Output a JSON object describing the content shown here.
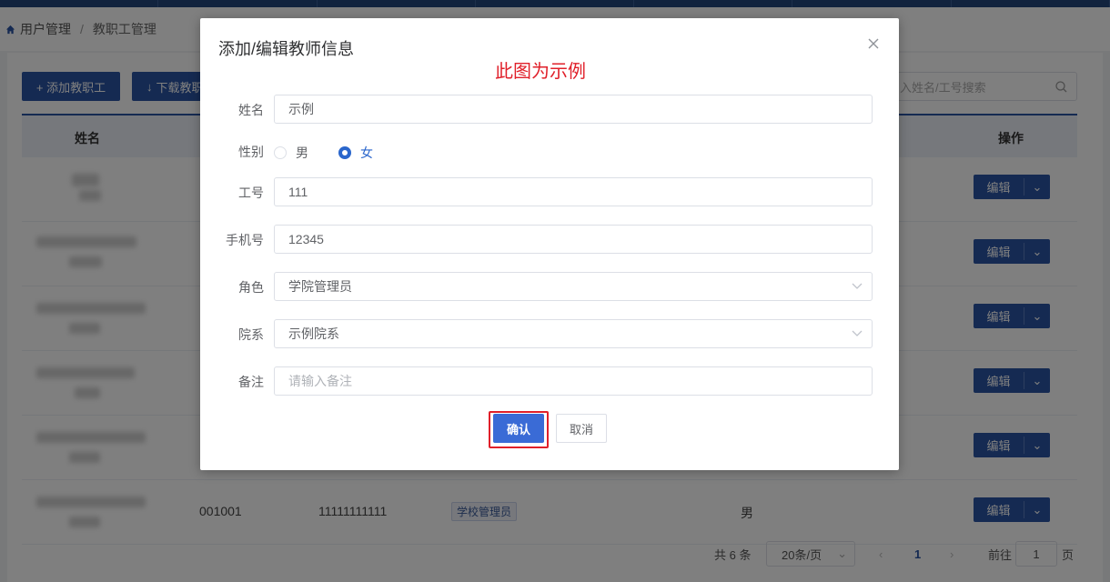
{
  "breadcrumb": {
    "root": "用户管理",
    "separator": "/",
    "current": "教职工管理"
  },
  "toolbar": {
    "add_label": "+ 添加教职工",
    "download_label": "下载教职"
  },
  "search": {
    "placeholder": "入姓名/工号搜索"
  },
  "table": {
    "headers": {
      "name": "姓名",
      "ops": "操作"
    },
    "rows": [
      {
        "id": "",
        "phone": "",
        "tag": "",
        "gender": ""
      },
      {
        "id": "",
        "phone": "",
        "tag": "",
        "gender": ""
      },
      {
        "id": "",
        "phone": "",
        "tag": "",
        "gender": ""
      },
      {
        "id": "",
        "phone": "",
        "tag": "",
        "gender": ""
      },
      {
        "id": "",
        "phone": "",
        "tag": "",
        "gender": ""
      },
      {
        "id": "001001",
        "phone": "11111111111",
        "tag": "学校管理员",
        "gender": "男"
      }
    ],
    "edit_label": "编辑"
  },
  "pager": {
    "total": "共 6 条",
    "page_size": "20条/页",
    "current": "1",
    "goto_label": "前往",
    "goto_value": "1",
    "page_suffix": "页"
  },
  "dialog": {
    "title": "添加/编辑教师信息",
    "watermark": "此图为示例",
    "fields": {
      "name_label": "姓名",
      "name_value": "示例",
      "gender_label": "性别",
      "gender_male": "男",
      "gender_female": "女",
      "gender_selected": "女",
      "id_label": "工号",
      "id_value": "111",
      "phone_label": "手机号",
      "phone_value": "12345",
      "role_label": "角色",
      "role_value": "学院管理员",
      "dept_label": "院系",
      "dept_value": "示例院系",
      "note_label": "备注",
      "note_placeholder": "请输入备注"
    },
    "confirm_label": "确认",
    "cancel_label": "取消"
  },
  "colors": {
    "primary": "#2a55a5",
    "highlight": "#e0202a",
    "radio_on": "#2a66cc"
  }
}
